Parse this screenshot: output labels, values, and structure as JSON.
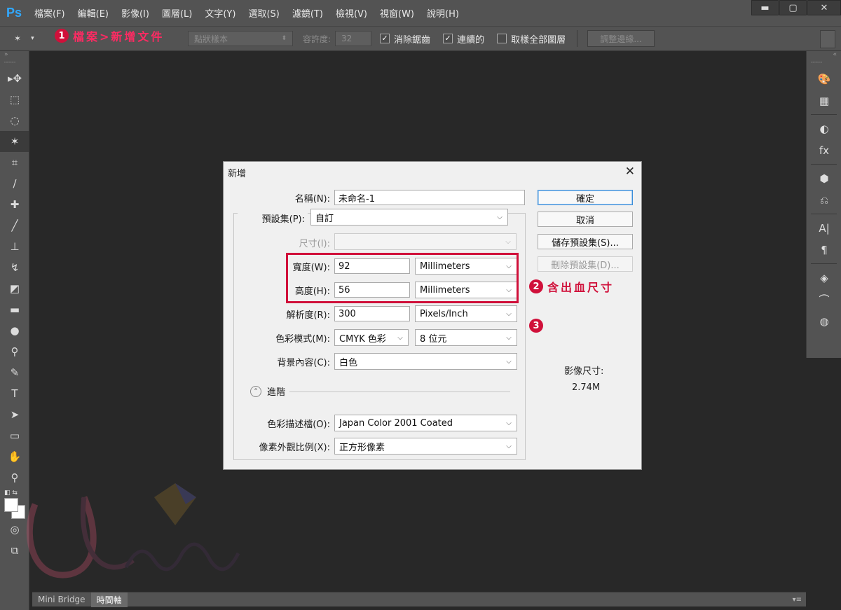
{
  "app": {
    "logo": "Ps"
  },
  "menu": [
    "檔案(F)",
    "編輯(E)",
    "影像(I)",
    "圖層(L)",
    "文字(Y)",
    "選取(S)",
    "濾鏡(T)",
    "檢視(V)",
    "視窗(W)",
    "說明(H)"
  ],
  "window_controls": {
    "minimize": "▬",
    "maximize": "▢",
    "close": "✕"
  },
  "options_bar": {
    "sample_size": "點狀樣本",
    "tolerance_label": "容許度:",
    "tolerance_value": "32",
    "antialias_label": "消除鋸齒",
    "contiguous_label": "連續的",
    "sample_all_label": "取樣全部圖層",
    "refine_button": "調整邊緣..."
  },
  "annotations": {
    "step1_num": "1",
    "step1_text": "檔案>新增文件",
    "step2_num": "2",
    "step2_text": "含出血尺寸",
    "step3_num": "3",
    "accent_color": "#d0103a"
  },
  "bottom_tabs": [
    "Mini Bridge",
    "時間軸"
  ],
  "dialog": {
    "title": "新增",
    "name_label": "名稱(N):",
    "name_value": "未命名-1",
    "preset_label": "預設集(P):",
    "preset_value": "自訂",
    "size_label": "尺寸(I):",
    "size_value": "",
    "width_label": "寬度(W):",
    "width_value": "92",
    "width_unit": "Millimeters",
    "height_label": "高度(H):",
    "height_value": "56",
    "height_unit": "Millimeters",
    "resolution_label": "解析度(R):",
    "resolution_value": "300",
    "resolution_unit": "Pixels/Inch",
    "color_mode_label": "色彩模式(M):",
    "color_mode_value": "CMYK 色彩",
    "bit_depth_value": "8 位元",
    "background_label": "背景內容(C):",
    "background_value": "白色",
    "advanced_label": "進階",
    "profile_label": "色彩描述檔(O):",
    "profile_value": "Japan Color 2001 Coated",
    "pixel_aspect_label": "像素外觀比例(X):",
    "pixel_aspect_value": "正方形像素",
    "ok_button": "確定",
    "cancel_button": "取消",
    "save_preset_button": "儲存預設集(S)...",
    "delete_preset_button": "刪除預設集(D)...",
    "image_size_label": "影像尺寸:",
    "image_size_value": "2.74M"
  }
}
